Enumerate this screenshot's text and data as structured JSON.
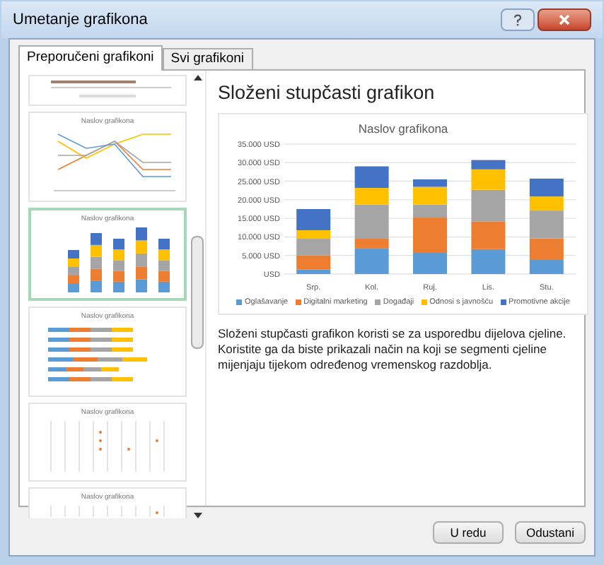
{
  "window": {
    "title": "Umetanje grafikona"
  },
  "tabs": [
    {
      "label": "Preporučeni grafikoni",
      "selected": true
    },
    {
      "label": "Svi grafikoni",
      "selected": false
    }
  ],
  "thumbnails": [
    {
      "kind": "bar-top",
      "selected": false
    },
    {
      "kind": "line",
      "title": "Naslov grafikona",
      "selected": false
    },
    {
      "kind": "column",
      "title": "Naslov grafikona",
      "selected": true
    },
    {
      "kind": "bar",
      "title": "Naslov grafikona",
      "selected": false
    },
    {
      "kind": "scatter",
      "title": "Naslov grafikona",
      "selected": false
    },
    {
      "kind": "scatter-cut",
      "title": "Naslov grafikona",
      "selected": false
    }
  ],
  "preview": {
    "heading": "Složeni stupčasti grafikon",
    "chart_data": {
      "type": "bar",
      "stacked": true,
      "title": "Naslov grafikona",
      "categories": [
        "Srp.",
        "Kol.",
        "Ruj.",
        "Lis.",
        "Stu."
      ],
      "series": [
        {
          "name": "Oglašavanje",
          "color": "#5b9bd5",
          "values": [
            1200,
            7000,
            5700,
            6700,
            3800
          ]
        },
        {
          "name": "Digitalni marketing",
          "color": "#ed7d31",
          "values": [
            3800,
            2500,
            9500,
            7500,
            5800
          ]
        },
        {
          "name": "Događaji",
          "color": "#a5a5a5",
          "values": [
            4500,
            9200,
            3500,
            8500,
            7500
          ]
        },
        {
          "name": "Odnosi s javnošću",
          "color": "#ffc000",
          "values": [
            2300,
            4500,
            4800,
            5500,
            3800
          ]
        },
        {
          "name": "Promotivne akcije",
          "color": "#4472c4",
          "values": [
            5700,
            5800,
            2000,
            2500,
            4800
          ]
        }
      ],
      "ylim": [
        0,
        35000
      ],
      "grid": true,
      "legend": "bottom",
      "yticks": [
        {
          "value": 0,
          "label": "USD"
        },
        {
          "value": 5000,
          "label": "5.000 USD"
        },
        {
          "value": 10000,
          "label": "10.000 USD"
        },
        {
          "value": 15000,
          "label": "15.000 USD"
        },
        {
          "value": 20000,
          "label": "20.000 USD"
        },
        {
          "value": 25000,
          "label": "25.000 USD"
        },
        {
          "value": 30000,
          "label": "30.000 USD"
        },
        {
          "value": 35000,
          "label": "35.000 USD"
        }
      ]
    },
    "description": "Složeni stupčasti grafikon koristi se za usporedbu dijelova cjeline. Koristite ga da biste prikazali način na koji se segmenti cjeline mijenjaju tijekom određenog vremenskog razdoblja."
  },
  "buttons": [
    "U redu",
    "Odustani"
  ]
}
